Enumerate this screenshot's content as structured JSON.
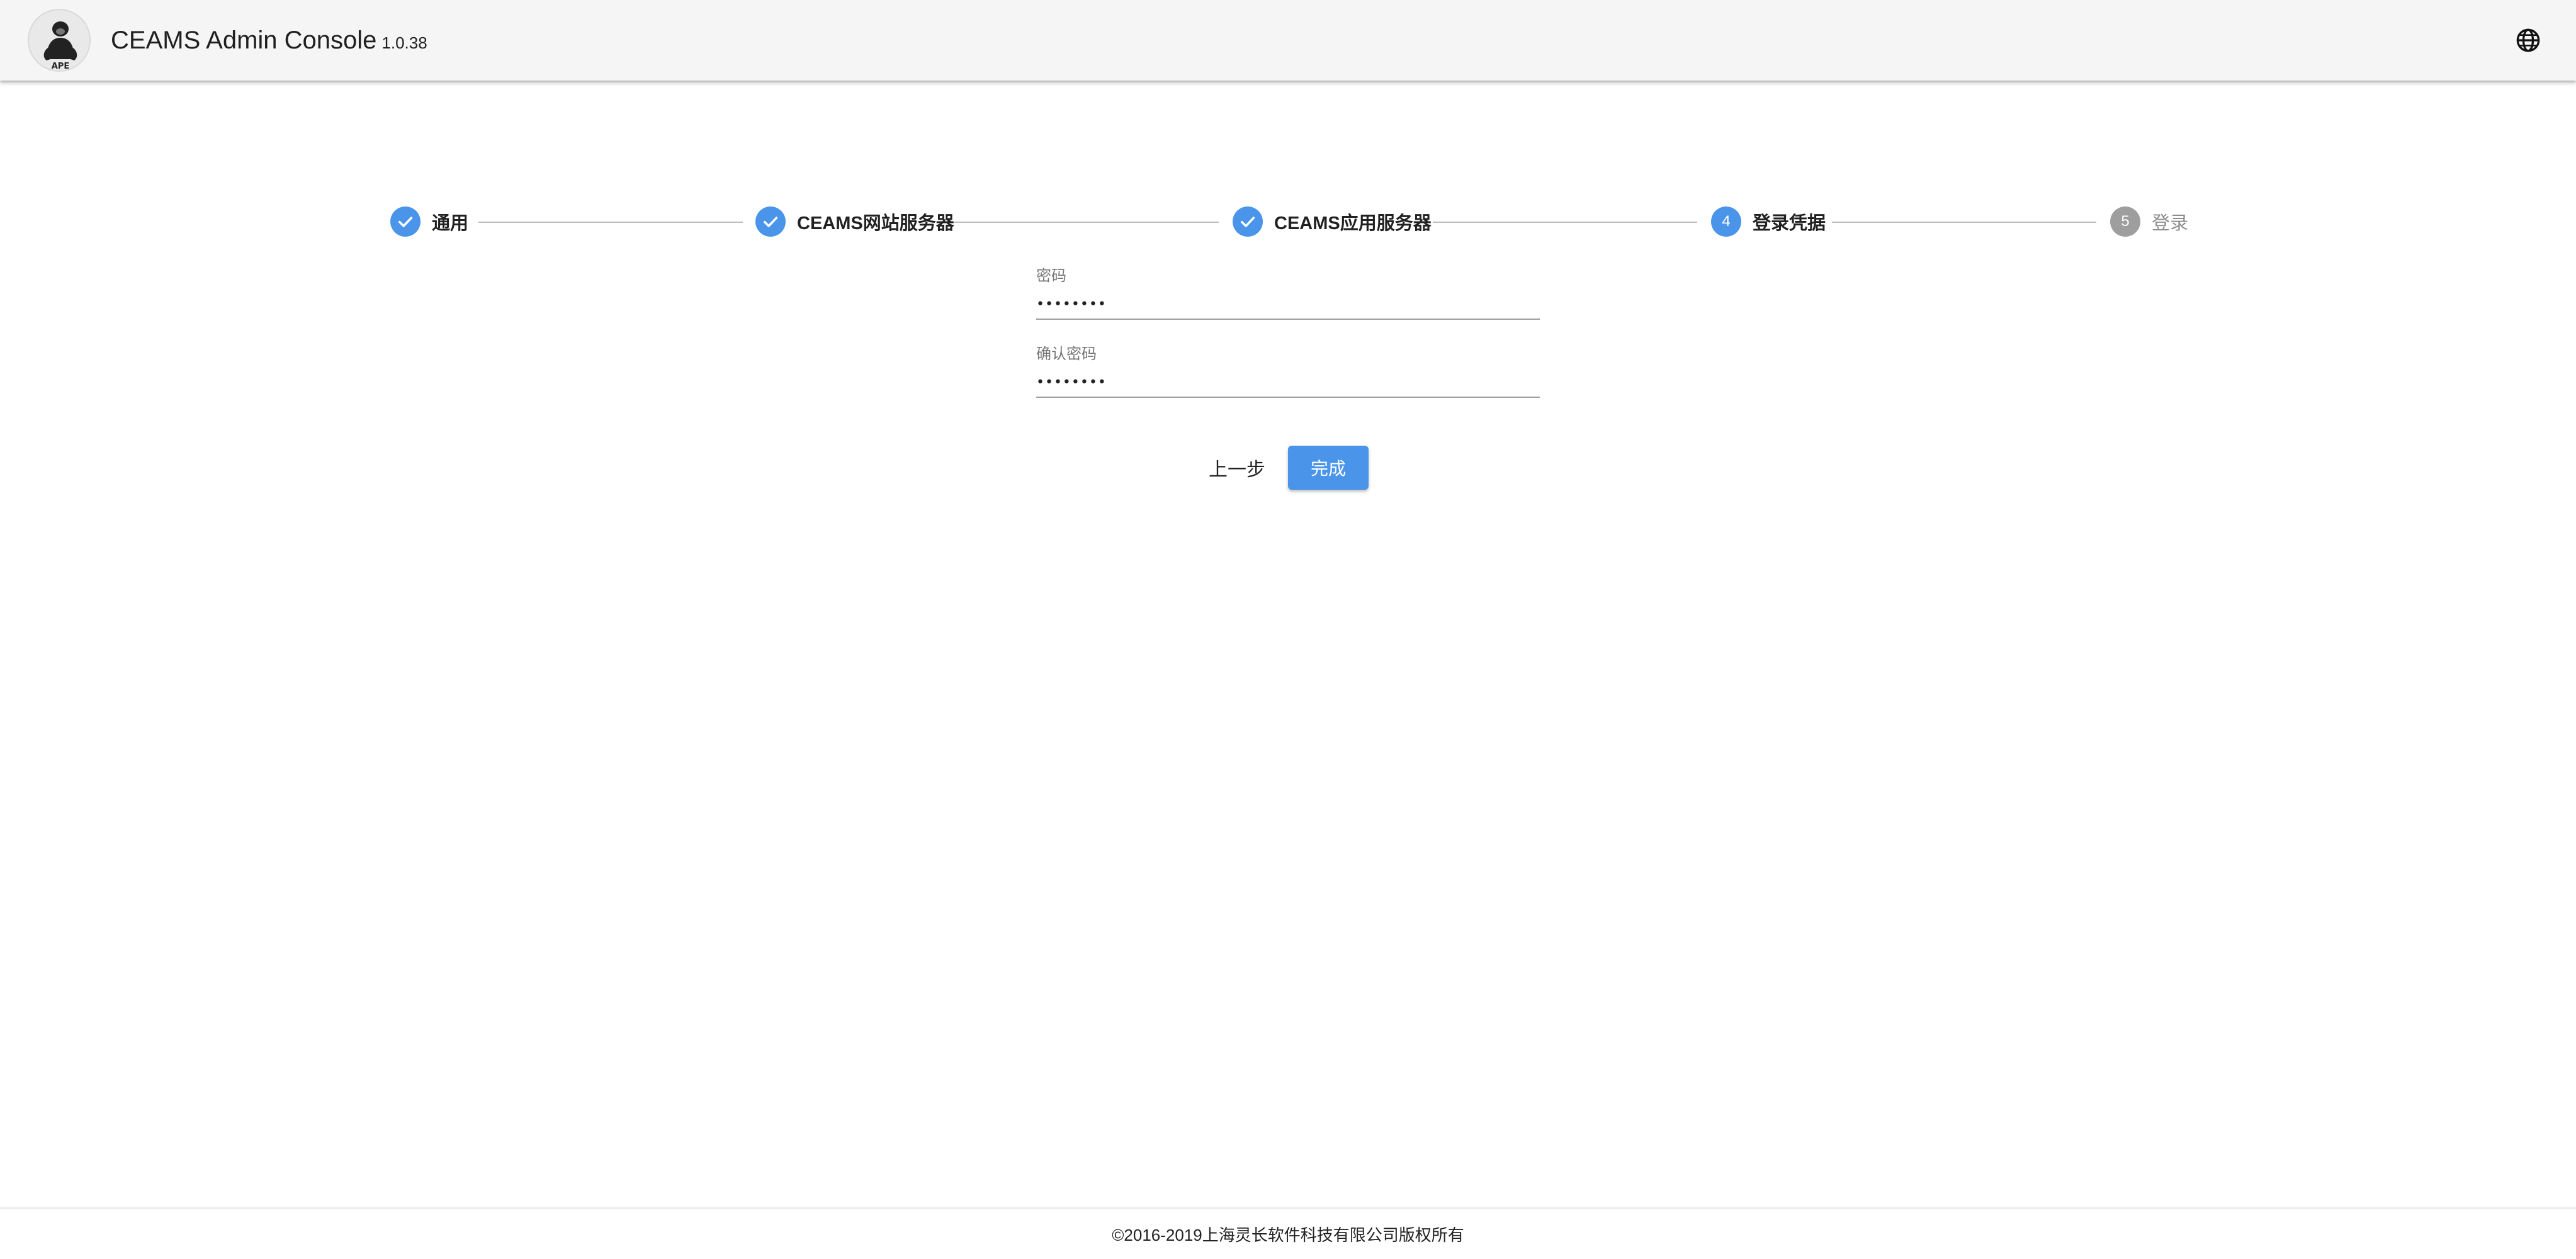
{
  "header": {
    "app_title": "CEAMS Admin Console",
    "version": "1.0.38",
    "logo_icon": "gorilla-ape-logo",
    "language_icon": "globe-icon"
  },
  "stepper": {
    "active_color": "#4a95ea",
    "inactive_color": "#9e9e9e",
    "steps": [
      {
        "label": "通用",
        "status": "completed",
        "icon": "check-icon"
      },
      {
        "label": "CEAMS网站服务器",
        "status": "completed",
        "icon": "check-icon"
      },
      {
        "label": "CEAMS应用服务器",
        "status": "completed",
        "icon": "check-icon"
      },
      {
        "label": "登录凭据",
        "status": "active",
        "number": "4"
      },
      {
        "label": "登录",
        "status": "inactive",
        "number": "5"
      }
    ]
  },
  "form": {
    "password": {
      "label": "密码",
      "value": "••••••••"
    },
    "confirm_password": {
      "label": "确认密码",
      "value": "••••••••"
    }
  },
  "actions": {
    "prev_label": "上一步",
    "finish_label": "完成"
  },
  "footer": {
    "copyright": "©2016-2019上海灵长软件科技有限公司版权所有"
  }
}
